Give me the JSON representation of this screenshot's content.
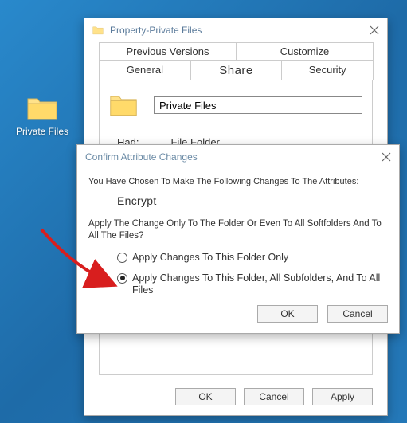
{
  "desktop": {
    "icon_label": "Private Files"
  },
  "prop_window": {
    "title": "Property-Private Files",
    "tabs_top": {
      "prev_versions": "Previous Versions",
      "customize": "Customize"
    },
    "tabs_bottom": {
      "general": "General",
      "share": "Share",
      "security": "Security"
    },
    "name_value": "Private Files",
    "row_had_label": "Had:",
    "row_had_value": "File Folder",
    "buttons": {
      "ok": "OK",
      "cancel": "Cancel",
      "apply": "Apply"
    }
  },
  "attr_window": {
    "title": "Confirm Attribute Changes",
    "line1": "You Have Chosen To Make The Following Changes To The Attributes:",
    "encrypt": "Encrypt",
    "question": "Apply The Change Only To The Folder Or Even To All Softfolders And To All The Files?",
    "opt1": "Apply Changes To This Folder Only",
    "opt2": "Apply Changes To This Folder, All Subfolders, And To All Files",
    "buttons": {
      "ok": "OK",
      "cancel": "Cancel"
    }
  }
}
